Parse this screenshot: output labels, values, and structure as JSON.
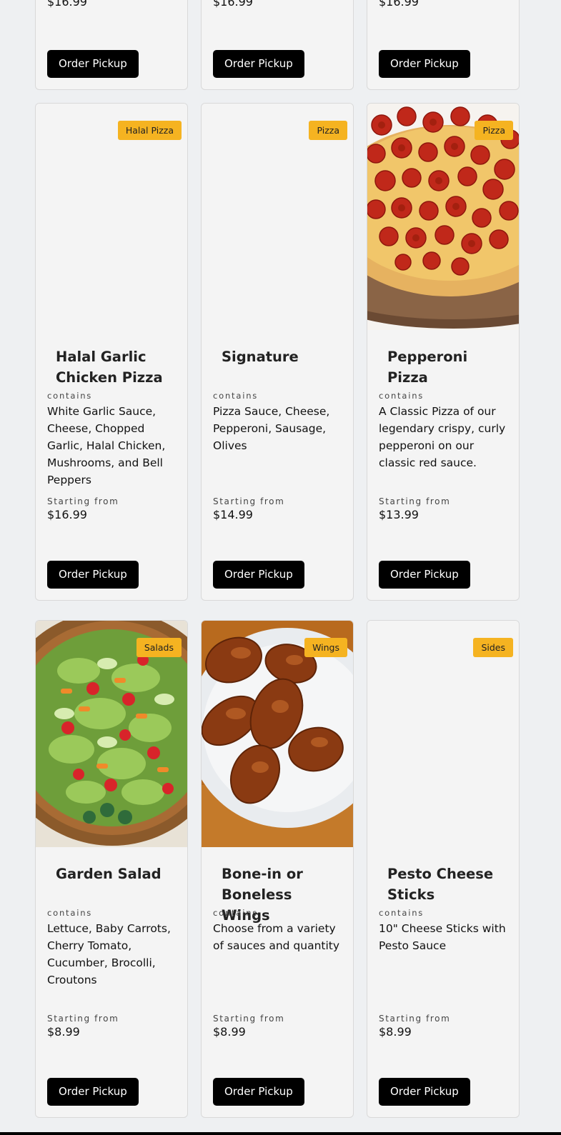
{
  "top_row": [
    {
      "price": "$16.99",
      "button": "Order Pickup"
    },
    {
      "price": "$16.99",
      "button": "Order Pickup"
    },
    {
      "price": "$16.99",
      "button": "Order Pickup"
    }
  ],
  "menu_items": [
    {
      "badge": "Halal Pizza",
      "title": "Halal Garlic Chicken Pizza",
      "contains_label": "contains",
      "description": "White Garlic Sauce, Cheese, Chopped Garlic, Halal Chicken, Mushrooms, and Bell Peppers",
      "starting_label": "Starting from",
      "price": "$16.99",
      "button": "Order Pickup",
      "image": "none"
    },
    {
      "badge": "Pizza",
      "title": "Signature",
      "contains_label": "contains",
      "description": "Pizza Sauce, Cheese, Pepperoni, Sausage, Olives",
      "starting_label": "Starting from",
      "price": "$14.99",
      "button": "Order Pickup",
      "image": "none"
    },
    {
      "badge": "Pizza",
      "title": "Pepperoni Pizza",
      "contains_label": "contains",
      "description": "A Classic Pizza of our legendary crispy, curly pepperoni on our classic red sauce.",
      "starting_label": "Starting from",
      "price": "$13.99",
      "button": "Order Pickup",
      "image": "pepperoni-pizza-photo"
    },
    {
      "badge": "Salads",
      "title": "Garden Salad",
      "contains_label": "contains",
      "description": "Lettuce, Baby Carrots, Cherry Tomato, Cucumber, Brocolli, Croutons",
      "starting_label": "Starting from",
      "price": "$8.99",
      "button": "Order Pickup",
      "image": "garden-salad-photo"
    },
    {
      "badge": "Wings",
      "title": "Bone-in or Boneless Wings",
      "contains_label": "contains",
      "description": "Choose from a variety of sauces and quantity",
      "starting_label": "Starting from",
      "price": "$8.99",
      "button": "Order Pickup",
      "image": "chicken-wings-photo"
    },
    {
      "badge": "Sides",
      "title": "Pesto Cheese Sticks",
      "contains_label": "contains",
      "description": "10\" Cheese Sticks with Pesto Sauce",
      "starting_label": "Starting from",
      "price": "$8.99",
      "button": "Order Pickup",
      "image": "none"
    }
  ],
  "colors": {
    "badge": "#f5b321",
    "button": "#000000",
    "card": "#f4f4f4",
    "page": "#eef0f2"
  }
}
